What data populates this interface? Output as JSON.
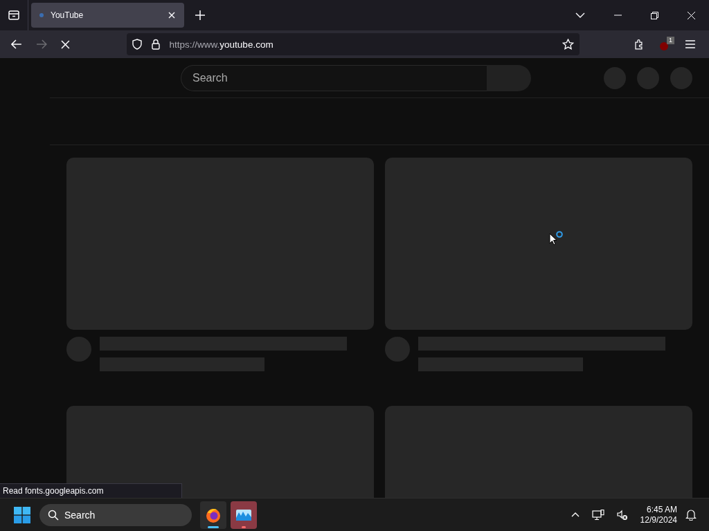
{
  "browser": {
    "tabs": [
      {
        "title": "YouTube",
        "selected": true
      }
    ],
    "address": {
      "prefix": "https://www.",
      "domain": "youtube.com"
    },
    "extension_badge": "1",
    "loading": true
  },
  "page": {
    "search": {
      "placeholder": "Search"
    },
    "videos": [
      {
        "kind": "skeleton"
      },
      {
        "kind": "skeleton"
      },
      {
        "kind": "thumbnail"
      },
      {
        "kind": "thumbnail"
      }
    ]
  },
  "status_text": "Read fonts.googleapis.com",
  "taskbar": {
    "search": {
      "placeholder": "Search"
    },
    "apps": [
      {
        "kind": "firefox",
        "selected": true,
        "flashing": false
      },
      {
        "kind": "photos",
        "selected": false,
        "flashing": true
      }
    ],
    "time": "6:45 AM",
    "date": "12/9/2024"
  }
}
